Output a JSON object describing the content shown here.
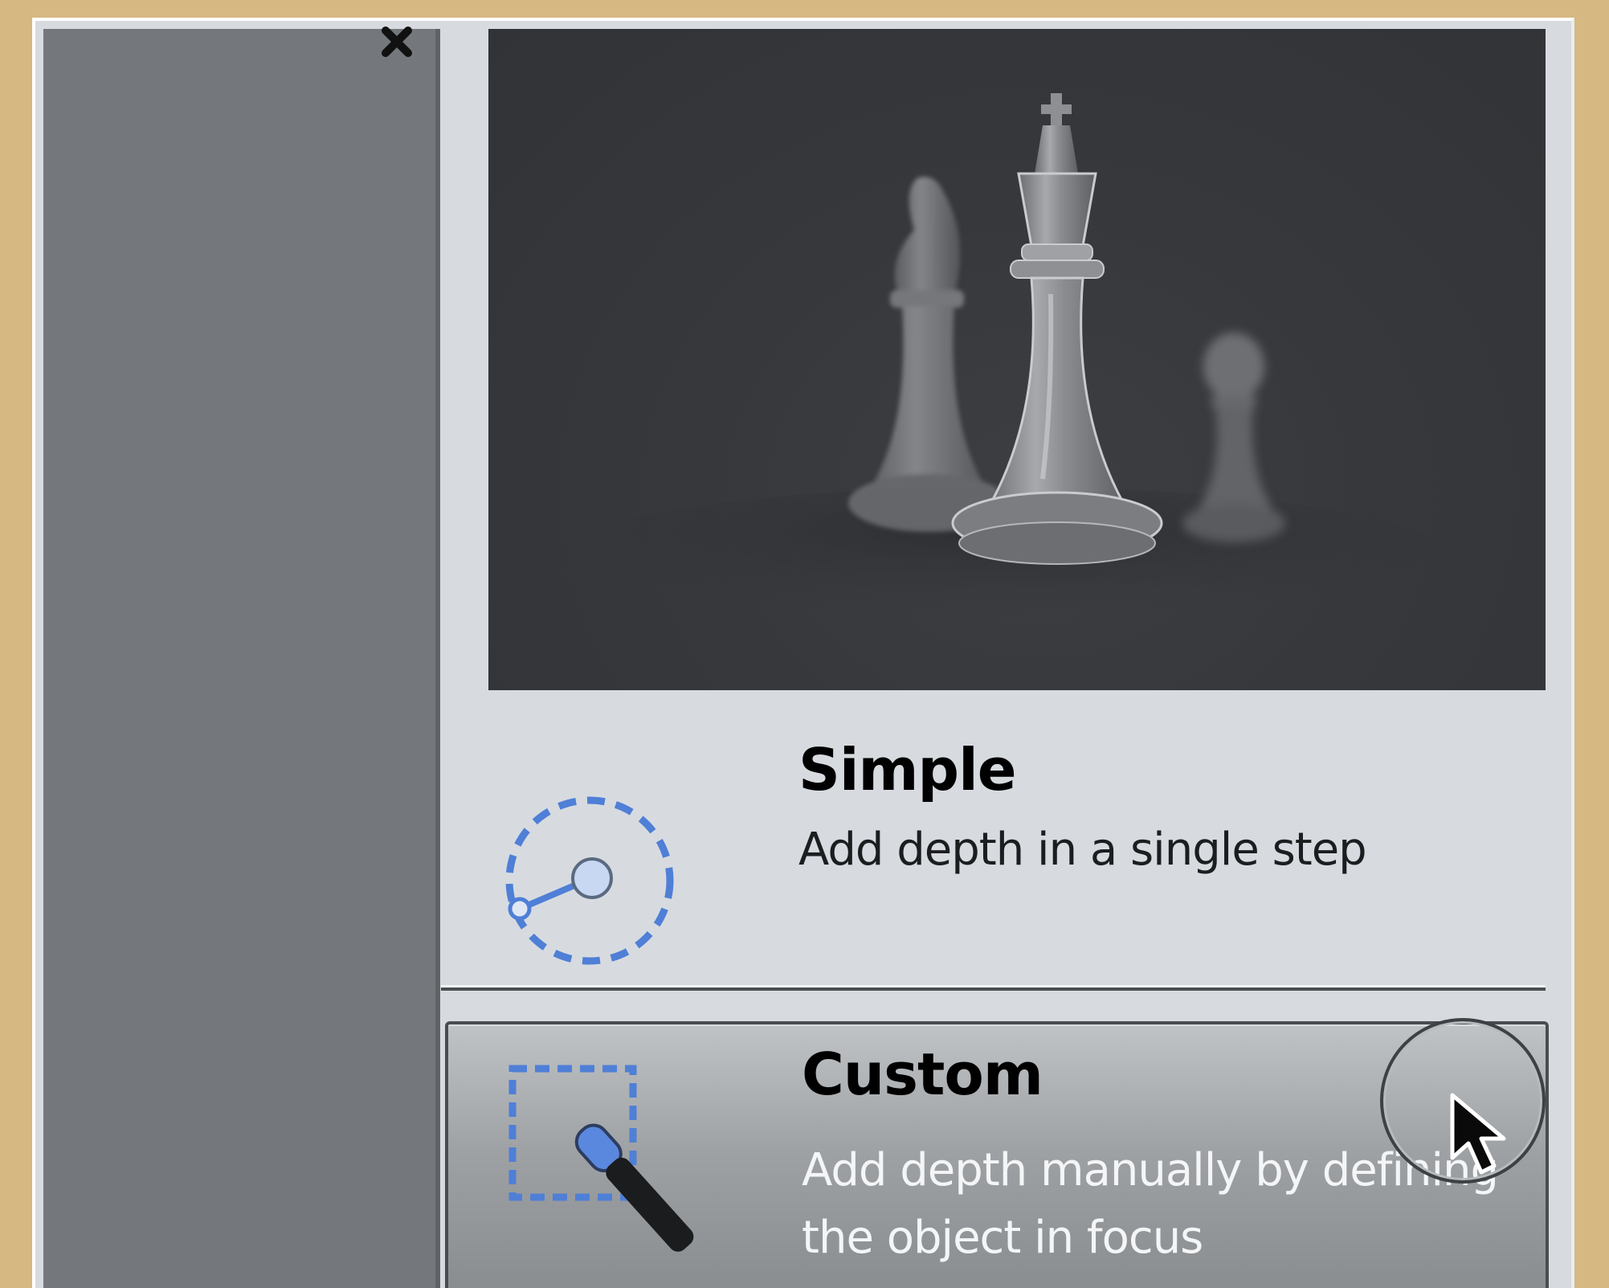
{
  "window": {
    "close_icon": "close-icon"
  },
  "preview": {
    "image": "chess-pieces-preview"
  },
  "options": {
    "simple": {
      "title": "Simple",
      "description": "Add depth in a single step",
      "icon": "circle-radius-icon"
    },
    "custom": {
      "title": "Custom",
      "description": "Add depth manually by defining the object in focus",
      "icon": "selection-brush-icon",
      "state": "hovered"
    }
  },
  "cursor": {
    "icon": "mouse-pointer-icon"
  },
  "colors": {
    "background": "#d6b883",
    "panel": "#d7dbe0",
    "sidebar": "#74787c",
    "preview_bg": "#36383c",
    "accent_blue": "#4f7fd6",
    "hover_row": "#9ea1a4"
  }
}
